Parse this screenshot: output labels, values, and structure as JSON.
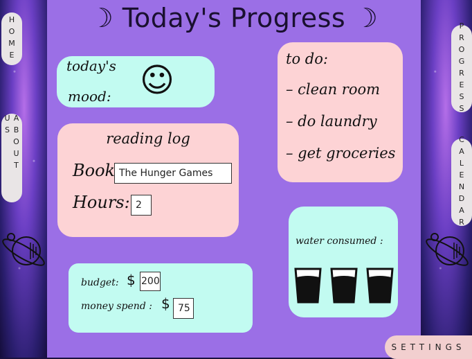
{
  "title": "☽ Today's Progress ☽",
  "nav": {
    "home": "HOME",
    "about": "ABOUT US",
    "progress": "PROGRESS",
    "calendar": "CALENDAR",
    "settings": "SETTINGS"
  },
  "mood": {
    "label_line1": "today's",
    "label_line2": "mood:",
    "face": "☺"
  },
  "todo": {
    "heading": "to do:",
    "items": [
      "– clean room",
      "– do laundry",
      "– get groceries"
    ]
  },
  "reading": {
    "heading": "reading log",
    "book_label": "Book:",
    "book_value": "The Hunger Games",
    "hours_label": "Hours:",
    "hours_value": "2"
  },
  "water": {
    "label": "water consumed :",
    "glasses": 3
  },
  "budget": {
    "budget_label": "budget:",
    "budget_symbol": "$",
    "budget_value": "200",
    "spent_label": "money spend :",
    "spent_symbol": "$",
    "spent_value": "75"
  },
  "colors": {
    "main_bg": "#9b6fe6",
    "mint": "#c2fbf1",
    "pink": "#fdd3d5"
  }
}
